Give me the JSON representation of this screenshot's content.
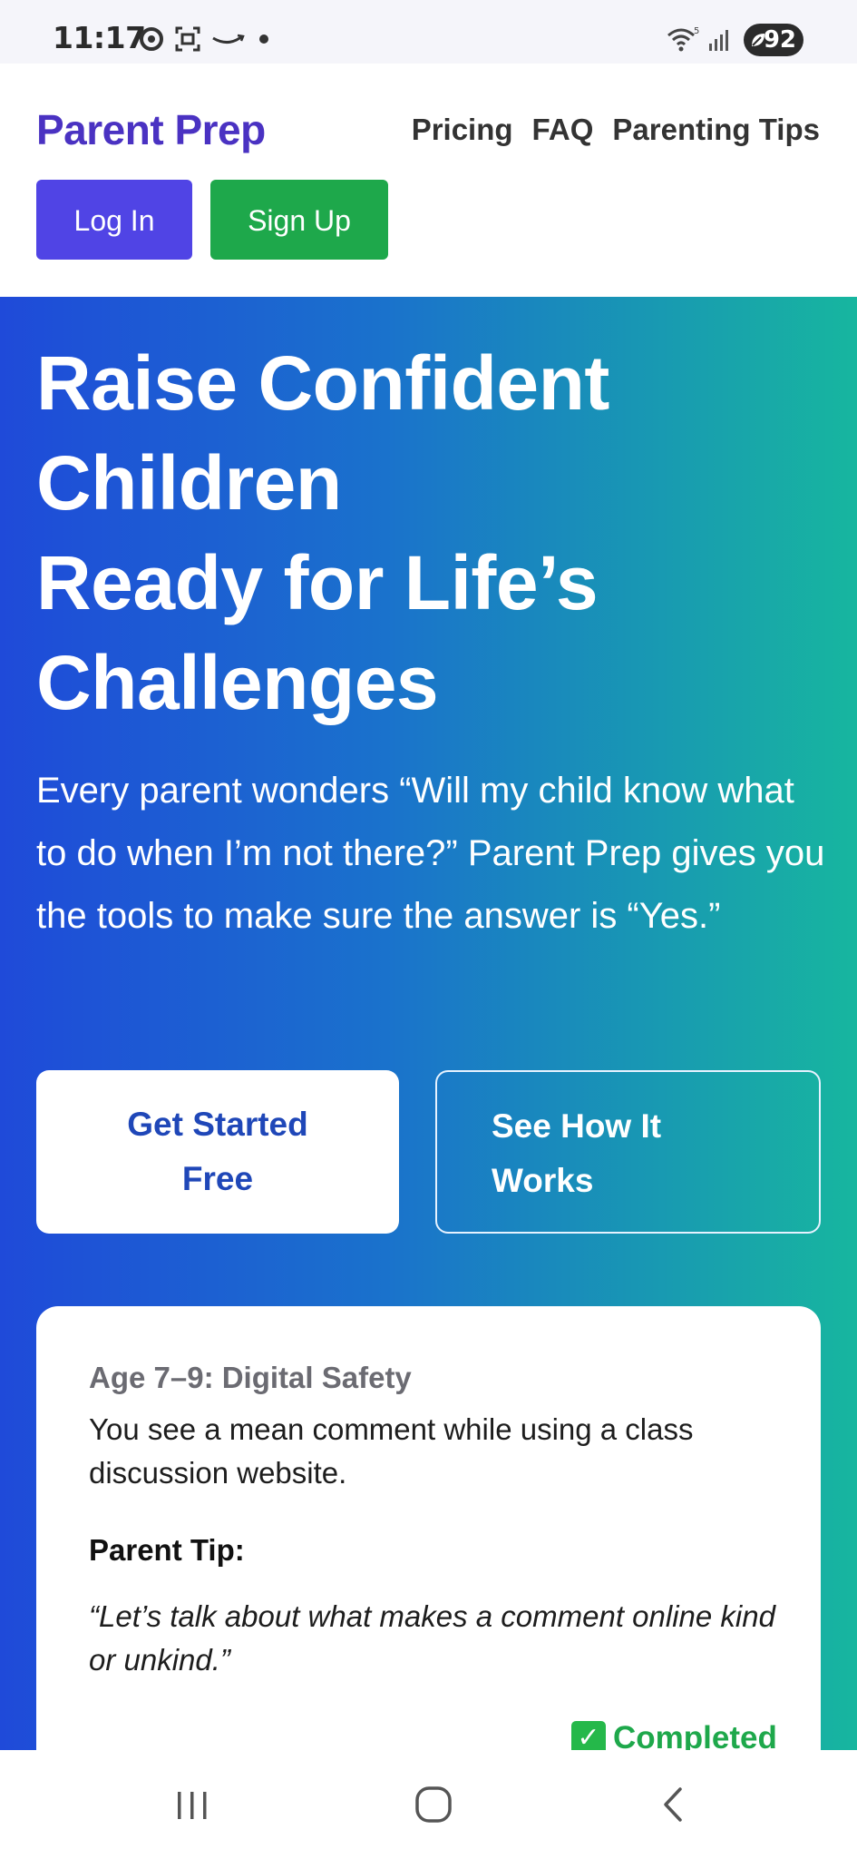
{
  "status_bar": {
    "time": "11:17",
    "battery": "92",
    "icons": [
      "sync-icon",
      "screenshot-icon",
      "amazon-icon",
      "notification-dot",
      "wifi-icon",
      "signal-icon",
      "battery-icon"
    ]
  },
  "header": {
    "logo": "Parent Prep",
    "nav": [
      "Pricing",
      "FAQ",
      "Parenting Tips"
    ],
    "login_label": "Log In",
    "signup_label": "Sign Up"
  },
  "hero": {
    "title_lines": [
      "Raise Confident",
      "Children",
      "Ready for Life’s",
      "Challenges"
    ],
    "subtitle": "Every parent wonders “Will my child know what to do when I’m not there?” Parent Prep gives you the tools to make sure the answer is “Yes.”",
    "cta_primary_lines": [
      "Get Started",
      "Free"
    ],
    "cta_secondary_lines": [
      "See How It",
      "Works"
    ]
  },
  "card": {
    "age_topic": "Age 7–9: Digital Safety",
    "scenario": "You see a mean comment while using a class discussion website.",
    "tip_label": "Parent Tip:",
    "tip": "“Let’s talk about what makes a comment online kind or unkind.”",
    "status": "Completed",
    "status_icon": "check-box-icon"
  },
  "bottom_nav": {
    "icons": [
      "recent-apps-icon",
      "home-icon",
      "back-icon"
    ]
  },
  "colors": {
    "brand": "#4a32c2",
    "login": "#5044e5",
    "signup": "#1ea84b",
    "gradient_start": "#1f4ad9",
    "gradient_end": "#17b69f",
    "completed": "#1ea84b"
  }
}
